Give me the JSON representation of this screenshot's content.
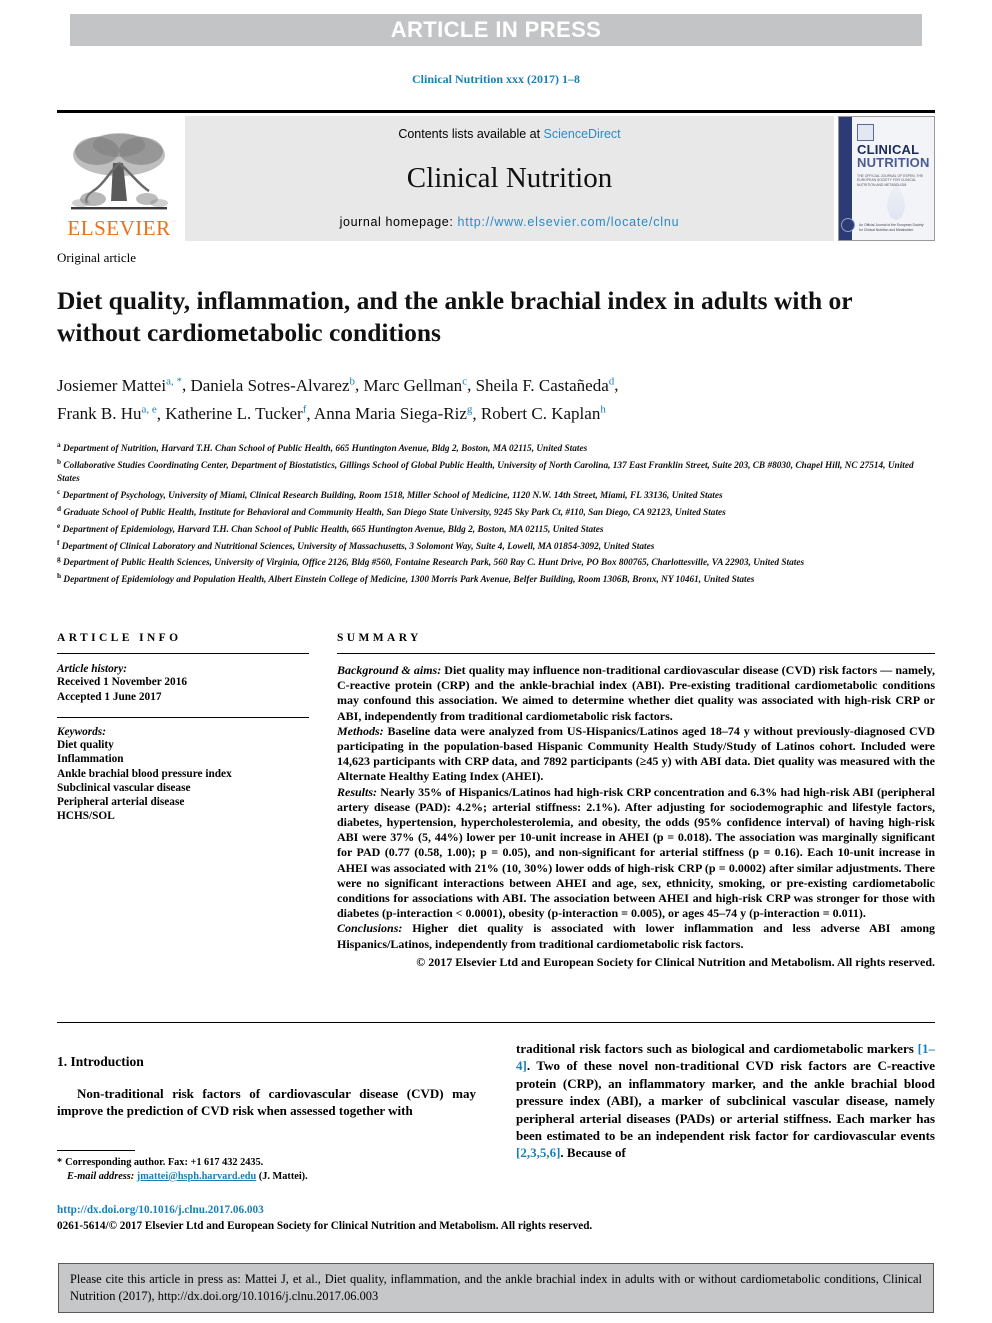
{
  "banner": {
    "text": "ARTICLE IN PRESS"
  },
  "journal_ref": "Clinical Nutrition xxx (2017) 1–8",
  "masthead": {
    "contents_prefix": "Contents lists available at ",
    "contents_link": "ScienceDirect",
    "journal_name": "Clinical Nutrition",
    "homepage_prefix": "journal homepage: ",
    "homepage_link": "http://www.elsevier.com/locate/clnu",
    "publisher": "ELSEVIER",
    "cover": {
      "title_line1": "CLINICAL",
      "title_line2": "NUTRITION",
      "subtitle": "THE OFFICIAL JOURNAL OF ESPEN, THE EUROPEAN SOCIETY FOR CLINICAL NUTRITION AND METABOLISM",
      "footnote": "An Official Journal of the European Society for Clinical Nutrition and Metabolism"
    }
  },
  "article": {
    "type": "Original article",
    "title": "Diet quality, inflammation, and the ankle brachial index in adults with or without cardiometabolic conditions",
    "authors": [
      {
        "name": "Josiemer Mattei",
        "sup": "a, *"
      },
      {
        "name": "Daniela Sotres-Alvarez",
        "sup": "b"
      },
      {
        "name": "Marc Gellman",
        "sup": "c"
      },
      {
        "name": "Sheila F. Castañeda",
        "sup": "d"
      },
      {
        "name": "Frank B. Hu",
        "sup": "a, e"
      },
      {
        "name": "Katherine L. Tucker",
        "sup": "f"
      },
      {
        "name": "Anna Maria Siega-Riz",
        "sup": "g"
      },
      {
        "name": "Robert C. Kaplan",
        "sup": "h"
      }
    ],
    "affiliations": [
      {
        "mark": "a",
        "text": "Department of Nutrition, Harvard T.H. Chan School of Public Health, 665 Huntington Avenue, Bldg 2, Boston, MA 02115, United States"
      },
      {
        "mark": "b",
        "text": "Collaborative Studies Coordinating Center, Department of Biostatistics, Gillings School of Global Public Health, University of North Carolina, 137 East Franklin Street, Suite 203, CB #8030, Chapel Hill, NC 27514, United States"
      },
      {
        "mark": "c",
        "text": "Department of Psychology, University of Miami, Clinical Research Building, Room 1518, Miller School of Medicine, 1120 N.W. 14th Street, Miami, FL 33136, United States"
      },
      {
        "mark": "d",
        "text": "Graduate School of Public Health, Institute for Behavioral and Community Health, San Diego State University, 9245 Sky Park Ct, #110, San Diego, CA 92123, United States"
      },
      {
        "mark": "e",
        "text": "Department of Epidemiology, Harvard T.H. Chan School of Public Health, 665 Huntington Avenue, Bldg 2, Boston, MA 02115, United States"
      },
      {
        "mark": "f",
        "text": "Department of Clinical Laboratory and Nutritional Sciences, University of Massachusetts, 3 Solomont Way, Suite 4, Lowell, MA 01854-3092, United States"
      },
      {
        "mark": "g",
        "text": "Department of Public Health Sciences, University of Virginia, Office 2126, Bldg #560, Fontaine Research Park, 560 Ray C. Hunt Drive, PO Box 800765, Charlottesville, VA 22903, United States"
      },
      {
        "mark": "h",
        "text": "Department of Epidemiology and Population Health, Albert Einstein College of Medicine, 1300 Morris Park Avenue, Belfer Building, Room 1306B, Bronx, NY 10461, United States"
      }
    ]
  },
  "info": {
    "heading": "ARTICLE INFO",
    "history_label": "Article history:",
    "received": "Received 1 November 2016",
    "accepted": "Accepted 1 June 2017",
    "keywords_label": "Keywords:",
    "keywords": [
      "Diet quality",
      "Inflammation",
      "Ankle brachial blood pressure index",
      "Subclinical vascular disease",
      "Peripheral arterial disease",
      "HCHS/SOL"
    ]
  },
  "summary": {
    "heading": "SUMMARY",
    "background_label": "Background & aims:",
    "background_text": " Diet quality may influence non-traditional cardiovascular disease (CVD) risk factors — namely, C-reactive protein (CRP) and the ankle-brachial index (ABI). Pre-existing traditional cardiometabolic conditions may confound this association. We aimed to determine whether diet quality was associated with high-risk CRP or ABI, independently from traditional cardiometabolic risk factors.",
    "methods_label": "Methods:",
    "methods_text": " Baseline data were analyzed from US-Hispanics/Latinos aged 18–74 y without previously-diagnosed CVD participating in the population-based Hispanic Community Health Study/Study of Latinos cohort. Included were 14,623 participants with CRP data, and 7892 participants (≥45 y) with ABI data. Diet quality was measured with the Alternate Healthy Eating Index (AHEI).",
    "results_label": "Results:",
    "results_text": " Nearly 35% of Hispanics/Latinos had high-risk CRP concentration and 6.3% had high-risk ABI (peripheral artery disease (PAD): 4.2%; arterial stiffness: 2.1%). After adjusting for sociodemographic and lifestyle factors, diabetes, hypertension, hypercholesterolemia, and obesity, the odds (95% confidence interval) of having high-risk ABI were 37% (5, 44%) lower per 10-unit increase in AHEI (p = 0.018). The association was marginally significant for PAD (0.77 (0.58, 1.00); p = 0.05), and non-significant for arterial stiffness (p = 0.16). Each 10-unit increase in AHEI was associated with 21% (10, 30%) lower odds of high-risk CRP (p = 0.0002) after similar adjustments. There were no significant interactions between AHEI and age, sex, ethnicity, smoking, or pre-existing cardiometabolic conditions for associations with ABI. The association between AHEI and high-risk CRP was stronger for those with diabetes (p-interaction < 0.0001), obesity (p-interaction = 0.005), or ages 45–74 y (p-interaction = 0.011).",
    "conclusions_label": "Conclusions:",
    "conclusions_text": " Higher diet quality is associated with lower inflammation and less adverse ABI among Hispanics/Latinos, independently from traditional cardiometabolic risk factors.",
    "copyright": "© 2017 Elsevier Ltd and European Society for Clinical Nutrition and Metabolism. All rights reserved."
  },
  "intro": {
    "heading": "1. Introduction",
    "col1_para": "Non-traditional risk factors of cardiovascular disease (CVD) may improve the prediction of CVD risk when assessed together with",
    "col2_part1": "traditional risk factors such as biological and cardiometabolic markers ",
    "col2_ref1": "[1–4]",
    "col2_part2": ". Two of these novel non-traditional CVD risk factors are C-reactive protein (CRP), an inflammatory marker, and the ankle brachial blood pressure index (ABI), a marker of subclinical vascular disease, namely peripheral arterial diseases (PADs) or arterial stiffness. Each marker has been estimated to be an independent risk factor for cardiovascular events ",
    "col2_ref2": "[2,3,5,6]",
    "col2_part3": ". Because of"
  },
  "footnotes": {
    "corresponding": "Corresponding author. Fax: +1 617 432 2435.",
    "email_label": "E-mail address:",
    "email": "jmattei@hsph.harvard.edu",
    "email_suffix": " (J. Mattei).",
    "doi": "http://dx.doi.org/10.1016/j.clnu.2017.06.003",
    "issn": "0261-5614/© 2017 Elsevier Ltd and European Society for Clinical Nutrition and Metabolism. All rights reserved."
  },
  "cite_box": {
    "text": "Please cite this article in press as: Mattei J, et al., Diet quality, inflammation, and the ankle brachial index in adults with or without cardiometabolic conditions, Clinical Nutrition (2017), http://dx.doi.org/10.1016/j.clnu.2017.06.003"
  },
  "colors": {
    "link": "#1a7fb5",
    "banner_bg": "#c3c4c6",
    "masthead_bg": "#e8e8e8",
    "elsevier_orange": "#e8711a",
    "cite_box_bg": "#c6c7c9"
  }
}
